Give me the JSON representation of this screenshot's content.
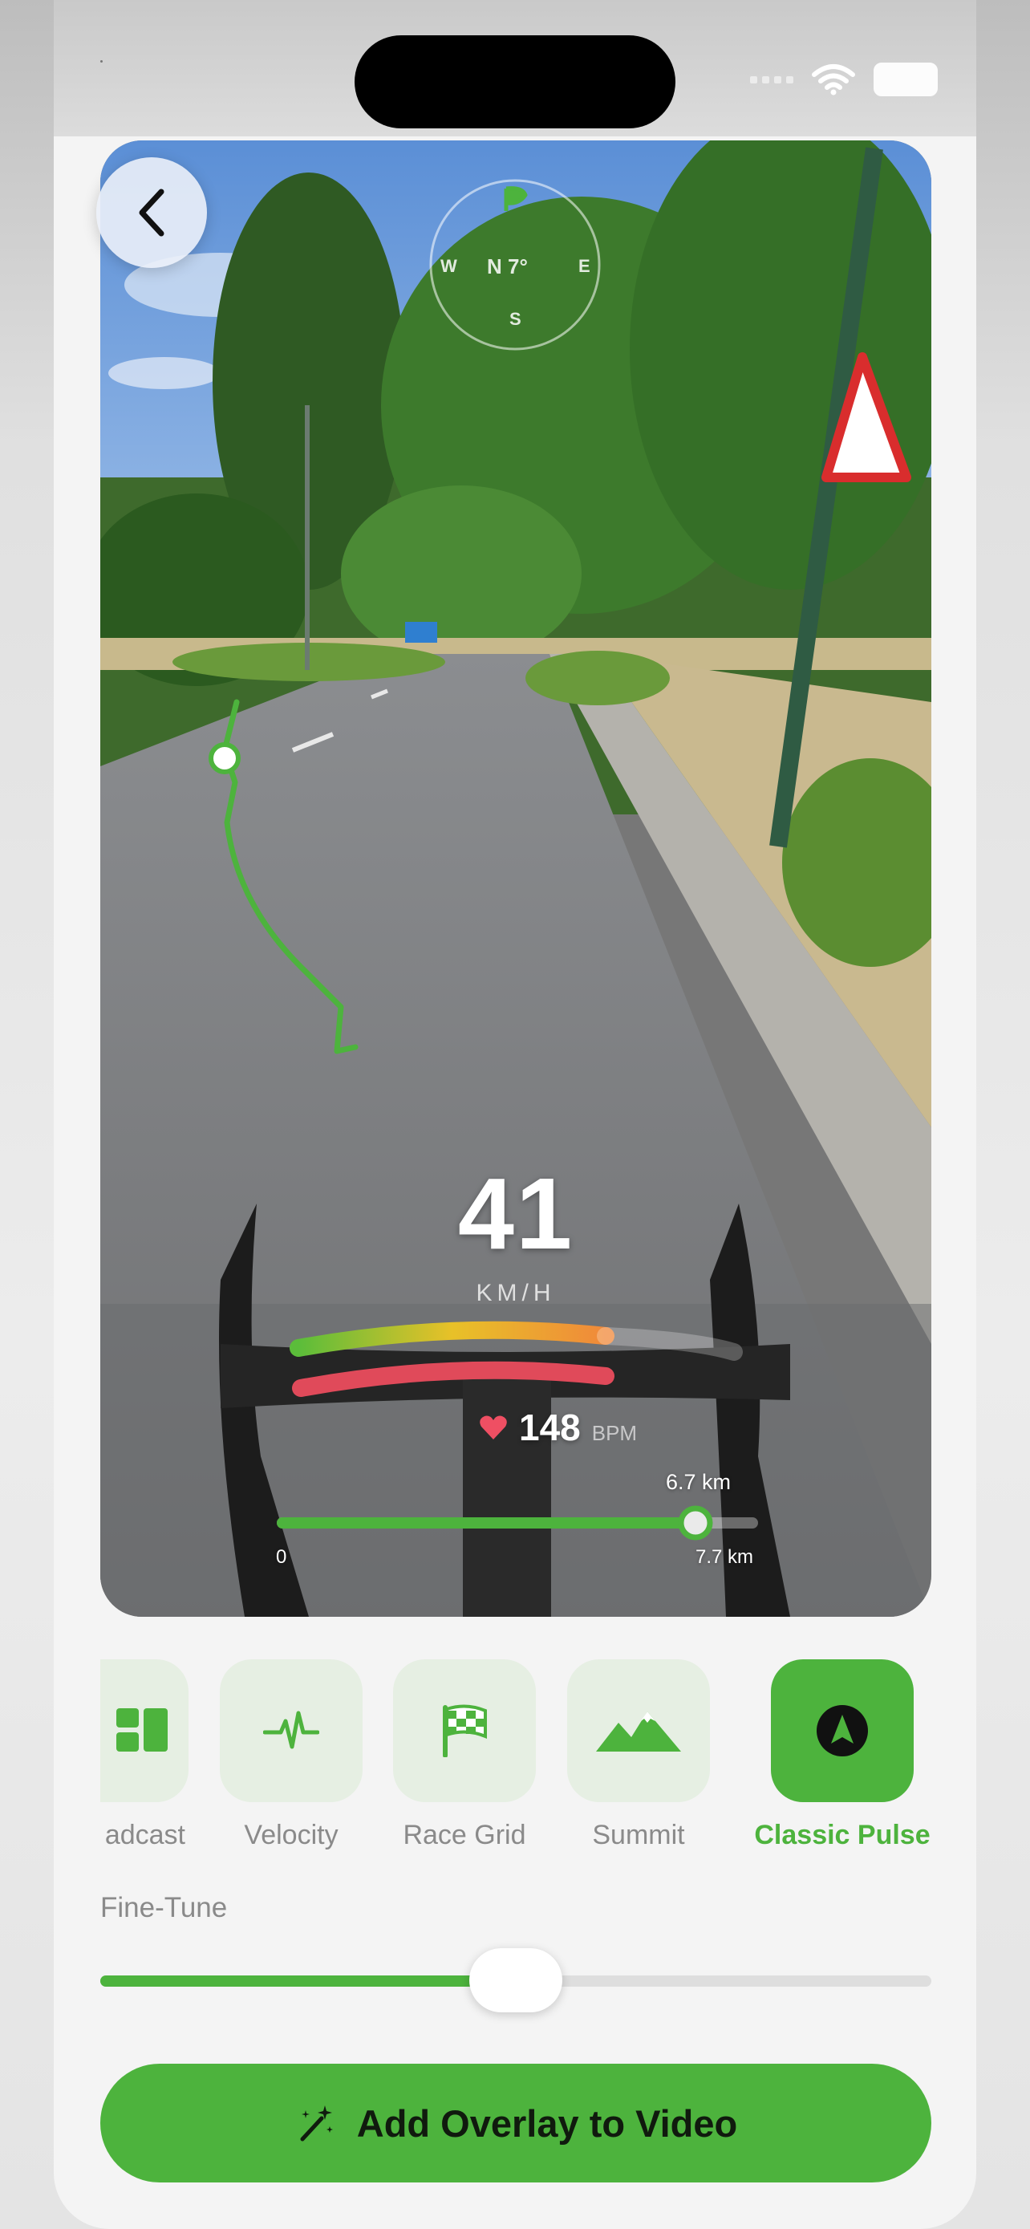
{
  "header": {
    "back_icon": "chevron-left-icon"
  },
  "compass": {
    "heading": "N 7°",
    "west": "W",
    "east": "E",
    "south": "S"
  },
  "overlay": {
    "speed": "41",
    "speed_unit": "KM/H",
    "heart_rate": "148",
    "heart_rate_unit": "BPM",
    "distance_current": "6.7 km",
    "distance_start": "0",
    "distance_total": "7.7 km",
    "distance_progress": 0.87,
    "route_color": "#4db33d"
  },
  "styles": {
    "items": [
      {
        "label": "adcast",
        "icon": "broadcast-grid-icon",
        "active": false
      },
      {
        "label": "Velocity",
        "icon": "pulse-line-icon",
        "active": false
      },
      {
        "label": "Race Grid",
        "icon": "checkered-flag-icon",
        "active": false
      },
      {
        "label": "Summit",
        "icon": "mountains-icon",
        "active": false
      },
      {
        "label": "Classic Pulse",
        "icon": "navigation-arrow-icon",
        "active": true
      }
    ]
  },
  "fine_tune": {
    "label": "Fine-Tune",
    "value": 0.5
  },
  "cta": {
    "label": "Add Overlay to Video",
    "icon": "magic-wand-icon"
  },
  "colors": {
    "accent": "#4db33d",
    "tile_bg": "#e6efe3",
    "label_gray": "#8a8a8a"
  }
}
